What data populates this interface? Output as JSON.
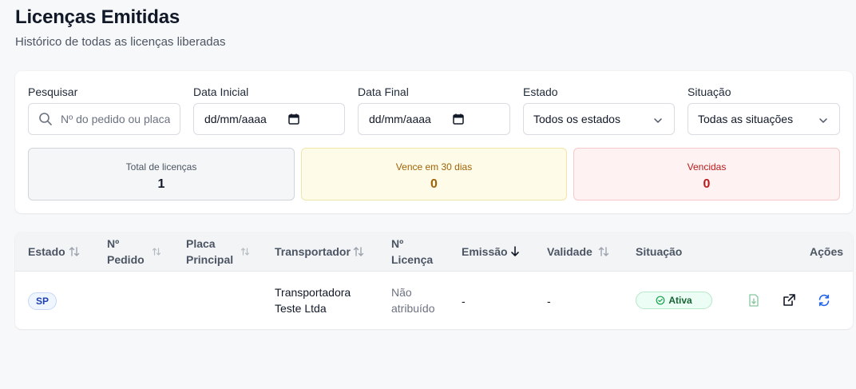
{
  "header": {
    "title": "Licenças Emitidas",
    "subtitle": "Histórico de todas as licenças liberadas"
  },
  "filters": {
    "search": {
      "label": "Pesquisar",
      "placeholder": "Nº do pedido ou placa",
      "icon": "search-icon"
    },
    "start_date": {
      "label": "Data Inicial",
      "value": "dd/mm/aaaa",
      "icon": "calendar-icon"
    },
    "end_date": {
      "label": "Data Final",
      "value": "dd/mm/aaaa",
      "icon": "calendar-icon"
    },
    "state": {
      "label": "Estado",
      "selected": "Todos os estados",
      "icon": "chevron-down-icon"
    },
    "status": {
      "label": "Situação",
      "selected": "Todas as situações",
      "icon": "chevron-down-icon"
    }
  },
  "stats": {
    "total": {
      "label": "Total de licenças",
      "value": "1"
    },
    "expiring": {
      "label": "Vence em 30 dias",
      "value": "0",
      "color": "#a16207"
    },
    "expired": {
      "label": "Vencidas",
      "value": "0",
      "color": "#b91c1c"
    }
  },
  "table": {
    "columns": {
      "estado": "Estado",
      "pedido_1": "Nº",
      "pedido_2": "Pedido",
      "placa_1": "Placa",
      "placa_2": "Principal",
      "transportador": "Transportador",
      "licenca_1": "Nº",
      "licenca_2": "Licença",
      "emissao": "Emissão",
      "validade": "Validade",
      "situacao": "Situação",
      "acoes": "Ações"
    },
    "rows": [
      {
        "estado": "SP",
        "pedido": "",
        "placa": "",
        "transportador_1": "Transportadora",
        "transportador_2": "Teste Ltda",
        "licenca_1": "Não",
        "licenca_2": "atribuído",
        "emissao": "-",
        "validade": "-",
        "situacao": "Ativa",
        "actions": [
          "download-icon",
          "external-link-icon",
          "refresh-icon"
        ]
      }
    ]
  },
  "colors": {
    "active_green": "#16a34a",
    "link_blue": "#2563eb",
    "download_green": "#86c79e"
  }
}
